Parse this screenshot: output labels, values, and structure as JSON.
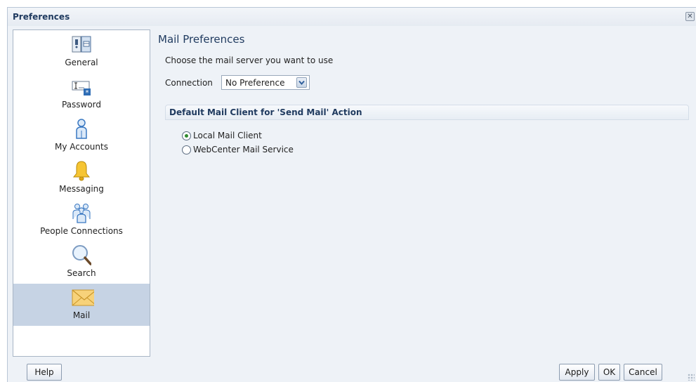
{
  "dialog": {
    "title": "Preferences",
    "close_icon": "close-icon"
  },
  "sidebar": {
    "items": [
      {
        "label": "General",
        "icon": "general-icon",
        "selected": false
      },
      {
        "label": "Password",
        "icon": "password-icon",
        "selected": false
      },
      {
        "label": "My Accounts",
        "icon": "user-icon",
        "selected": false
      },
      {
        "label": "Messaging",
        "icon": "bell-icon",
        "selected": false
      },
      {
        "label": "People Connections",
        "icon": "people-icon",
        "selected": false
      },
      {
        "label": "Search",
        "icon": "magnifier-icon",
        "selected": false
      },
      {
        "label": "Mail",
        "icon": "envelope-icon",
        "selected": true
      }
    ]
  },
  "main": {
    "heading": "Mail Preferences",
    "description": "Choose the mail server you want to use",
    "connection_label": "Connection",
    "connection_value": "No Preference",
    "section_title": "Default Mail Client for 'Send Mail' Action",
    "options": [
      {
        "label": "Local Mail Client",
        "checked": true
      },
      {
        "label": "WebCenter Mail Service",
        "checked": false
      }
    ]
  },
  "buttons": {
    "help": "Help",
    "apply": "Apply",
    "ok": "OK",
    "cancel": "Cancel"
  },
  "colors": {
    "selected_bg": "#c6d3e4",
    "heading": "#1f3a5f",
    "radio_checked": "#2f8a2f"
  }
}
